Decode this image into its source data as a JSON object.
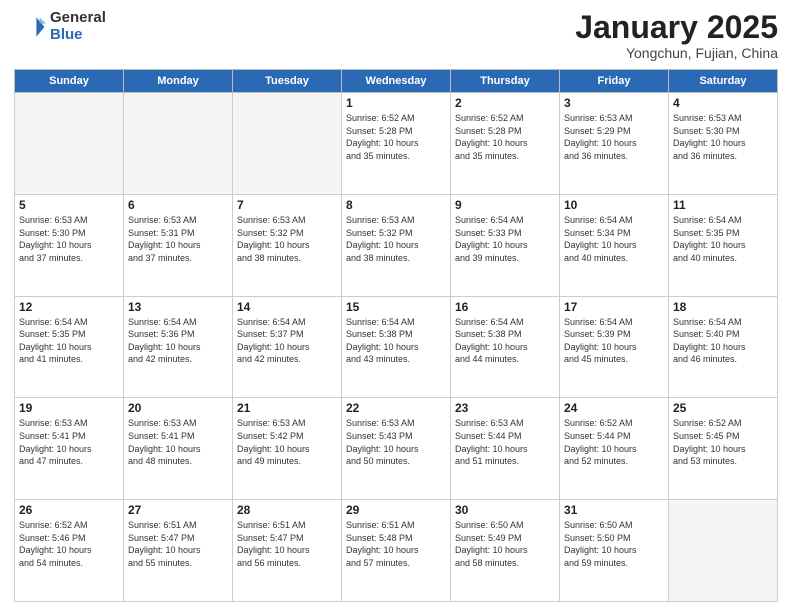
{
  "header": {
    "logo_general": "General",
    "logo_blue": "Blue",
    "month_title": "January 2025",
    "location": "Yongchun, Fujian, China"
  },
  "days_of_week": [
    "Sunday",
    "Monday",
    "Tuesday",
    "Wednesday",
    "Thursday",
    "Friday",
    "Saturday"
  ],
  "weeks": [
    [
      {
        "day": "",
        "info": ""
      },
      {
        "day": "",
        "info": ""
      },
      {
        "day": "",
        "info": ""
      },
      {
        "day": "1",
        "info": "Sunrise: 6:52 AM\nSunset: 5:28 PM\nDaylight: 10 hours\nand 35 minutes."
      },
      {
        "day": "2",
        "info": "Sunrise: 6:52 AM\nSunset: 5:28 PM\nDaylight: 10 hours\nand 35 minutes."
      },
      {
        "day": "3",
        "info": "Sunrise: 6:53 AM\nSunset: 5:29 PM\nDaylight: 10 hours\nand 36 minutes."
      },
      {
        "day": "4",
        "info": "Sunrise: 6:53 AM\nSunset: 5:30 PM\nDaylight: 10 hours\nand 36 minutes."
      }
    ],
    [
      {
        "day": "5",
        "info": "Sunrise: 6:53 AM\nSunset: 5:30 PM\nDaylight: 10 hours\nand 37 minutes."
      },
      {
        "day": "6",
        "info": "Sunrise: 6:53 AM\nSunset: 5:31 PM\nDaylight: 10 hours\nand 37 minutes."
      },
      {
        "day": "7",
        "info": "Sunrise: 6:53 AM\nSunset: 5:32 PM\nDaylight: 10 hours\nand 38 minutes."
      },
      {
        "day": "8",
        "info": "Sunrise: 6:53 AM\nSunset: 5:32 PM\nDaylight: 10 hours\nand 38 minutes."
      },
      {
        "day": "9",
        "info": "Sunrise: 6:54 AM\nSunset: 5:33 PM\nDaylight: 10 hours\nand 39 minutes."
      },
      {
        "day": "10",
        "info": "Sunrise: 6:54 AM\nSunset: 5:34 PM\nDaylight: 10 hours\nand 40 minutes."
      },
      {
        "day": "11",
        "info": "Sunrise: 6:54 AM\nSunset: 5:35 PM\nDaylight: 10 hours\nand 40 minutes."
      }
    ],
    [
      {
        "day": "12",
        "info": "Sunrise: 6:54 AM\nSunset: 5:35 PM\nDaylight: 10 hours\nand 41 minutes."
      },
      {
        "day": "13",
        "info": "Sunrise: 6:54 AM\nSunset: 5:36 PM\nDaylight: 10 hours\nand 42 minutes."
      },
      {
        "day": "14",
        "info": "Sunrise: 6:54 AM\nSunset: 5:37 PM\nDaylight: 10 hours\nand 42 minutes."
      },
      {
        "day": "15",
        "info": "Sunrise: 6:54 AM\nSunset: 5:38 PM\nDaylight: 10 hours\nand 43 minutes."
      },
      {
        "day": "16",
        "info": "Sunrise: 6:54 AM\nSunset: 5:38 PM\nDaylight: 10 hours\nand 44 minutes."
      },
      {
        "day": "17",
        "info": "Sunrise: 6:54 AM\nSunset: 5:39 PM\nDaylight: 10 hours\nand 45 minutes."
      },
      {
        "day": "18",
        "info": "Sunrise: 6:54 AM\nSunset: 5:40 PM\nDaylight: 10 hours\nand 46 minutes."
      }
    ],
    [
      {
        "day": "19",
        "info": "Sunrise: 6:53 AM\nSunset: 5:41 PM\nDaylight: 10 hours\nand 47 minutes."
      },
      {
        "day": "20",
        "info": "Sunrise: 6:53 AM\nSunset: 5:41 PM\nDaylight: 10 hours\nand 48 minutes."
      },
      {
        "day": "21",
        "info": "Sunrise: 6:53 AM\nSunset: 5:42 PM\nDaylight: 10 hours\nand 49 minutes."
      },
      {
        "day": "22",
        "info": "Sunrise: 6:53 AM\nSunset: 5:43 PM\nDaylight: 10 hours\nand 50 minutes."
      },
      {
        "day": "23",
        "info": "Sunrise: 6:53 AM\nSunset: 5:44 PM\nDaylight: 10 hours\nand 51 minutes."
      },
      {
        "day": "24",
        "info": "Sunrise: 6:52 AM\nSunset: 5:44 PM\nDaylight: 10 hours\nand 52 minutes."
      },
      {
        "day": "25",
        "info": "Sunrise: 6:52 AM\nSunset: 5:45 PM\nDaylight: 10 hours\nand 53 minutes."
      }
    ],
    [
      {
        "day": "26",
        "info": "Sunrise: 6:52 AM\nSunset: 5:46 PM\nDaylight: 10 hours\nand 54 minutes."
      },
      {
        "day": "27",
        "info": "Sunrise: 6:51 AM\nSunset: 5:47 PM\nDaylight: 10 hours\nand 55 minutes."
      },
      {
        "day": "28",
        "info": "Sunrise: 6:51 AM\nSunset: 5:47 PM\nDaylight: 10 hours\nand 56 minutes."
      },
      {
        "day": "29",
        "info": "Sunrise: 6:51 AM\nSunset: 5:48 PM\nDaylight: 10 hours\nand 57 minutes."
      },
      {
        "day": "30",
        "info": "Sunrise: 6:50 AM\nSunset: 5:49 PM\nDaylight: 10 hours\nand 58 minutes."
      },
      {
        "day": "31",
        "info": "Sunrise: 6:50 AM\nSunset: 5:50 PM\nDaylight: 10 hours\nand 59 minutes."
      },
      {
        "day": "",
        "info": ""
      }
    ]
  ]
}
